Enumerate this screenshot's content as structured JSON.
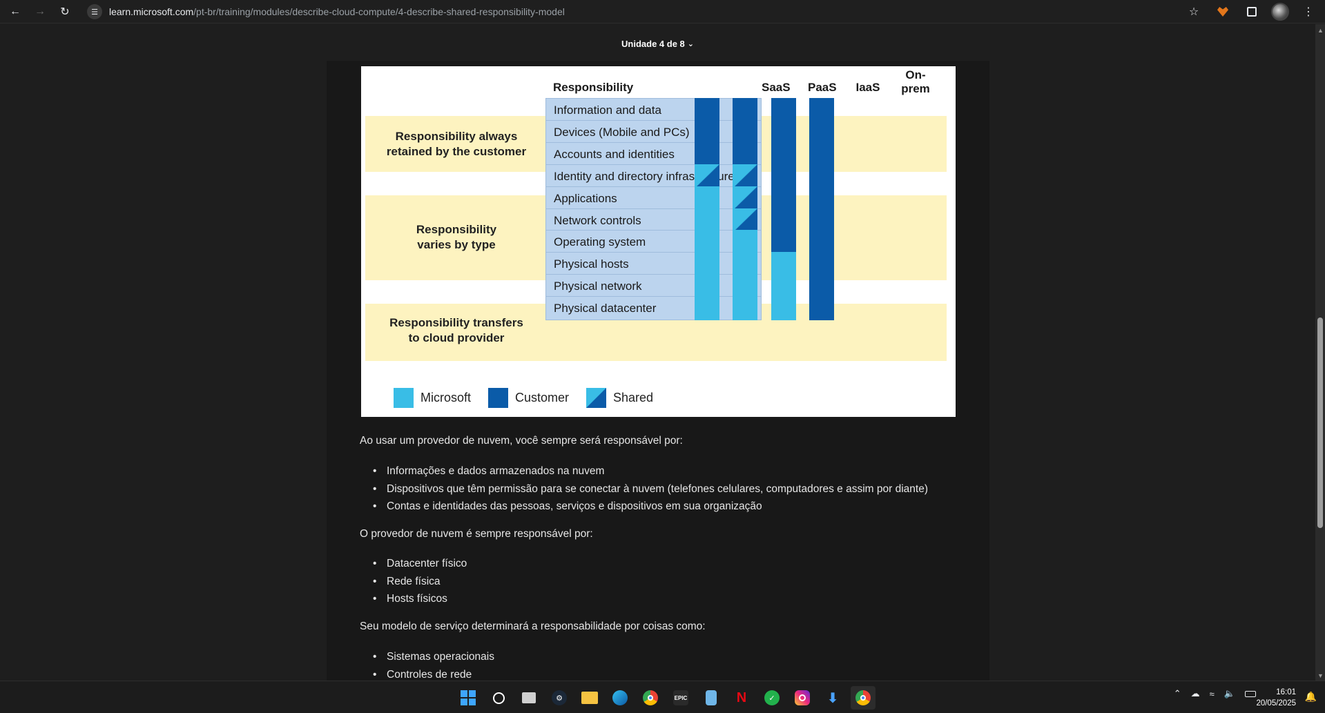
{
  "browser": {
    "back_icon": "arrow-left-icon",
    "forward_icon": "arrow-right-icon",
    "reload_icon": "reload-icon",
    "url_host": "learn.microsoft.com",
    "url_path": "/pt-br/training/modules/describe-cloud-compute/4-describe-shared-responsibility-model"
  },
  "unit_nav": {
    "label": "Unidade 4 de 8"
  },
  "diagram": {
    "header": {
      "responsibility": "Responsibility",
      "saas": "SaaS",
      "paas": "PaaS",
      "iaas": "IaaS",
      "onprem_1": "On-",
      "onprem_2": "prem"
    },
    "groups": [
      {
        "line1": "Responsibility always",
        "line2": "retained by the customer"
      },
      {
        "line1": "Responsibility",
        "line2": "varies by type"
      },
      {
        "line1": "Responsibility transfers",
        "line2": "to cloud provider"
      }
    ],
    "rows": [
      {
        "label": "Information and data",
        "cells": [
          "customer",
          "customer",
          "customer",
          "customer"
        ]
      },
      {
        "label": "Devices (Mobile and PCs)",
        "cells": [
          "customer",
          "customer",
          "customer",
          "customer"
        ]
      },
      {
        "label": "Accounts and identities",
        "cells": [
          "customer",
          "customer",
          "customer",
          "customer"
        ]
      },
      {
        "label": "Identity and directory infrastructure",
        "cells": [
          "shared",
          "shared",
          "customer",
          "customer"
        ]
      },
      {
        "label": "Applications",
        "cells": [
          "microsoft",
          "shared",
          "customer",
          "customer"
        ]
      },
      {
        "label": "Network controls",
        "cells": [
          "microsoft",
          "shared",
          "customer",
          "customer"
        ]
      },
      {
        "label": "Operating system",
        "cells": [
          "microsoft",
          "microsoft",
          "customer",
          "customer"
        ]
      },
      {
        "label": "Physical hosts",
        "cells": [
          "microsoft",
          "microsoft",
          "microsoft",
          "customer"
        ]
      },
      {
        "label": "Physical network",
        "cells": [
          "microsoft",
          "microsoft",
          "microsoft",
          "customer"
        ]
      },
      {
        "label": "Physical datacenter",
        "cells": [
          "microsoft",
          "microsoft",
          "microsoft",
          "customer"
        ]
      }
    ],
    "legend": {
      "microsoft": "Microsoft",
      "customer": "Customer",
      "shared": "Shared"
    },
    "colors": {
      "customer": "#0b5ba8",
      "microsoft": "#39bde6",
      "band": "#fdf3c0",
      "row_bg": "#bcd4ee"
    }
  },
  "article": {
    "p1": "Ao usar um provedor de nuvem, você sempre será responsável por:",
    "list1": [
      "Informações e dados armazenados na nuvem",
      "Dispositivos que têm permissão para se conectar à nuvem (telefones celulares, computadores e assim por diante)",
      "Contas e identidades das pessoas, serviços e dispositivos em sua organização"
    ],
    "p2": "O provedor de nuvem é sempre responsável por:",
    "list2": [
      "Datacenter físico",
      "Rede física",
      "Hosts físicos"
    ],
    "p3": "Seu modelo de serviço determinará a responsabilidade por coisas como:",
    "list3": [
      "Sistemas operacionais",
      "Controles de rede"
    ]
  },
  "taskbar": {
    "apps": [
      "windows-start",
      "search",
      "task-view",
      "steam",
      "file-explorer",
      "edge",
      "chrome",
      "epic-games",
      "notepad",
      "netflix",
      "app-green",
      "instagram",
      "download-manager",
      "chrome-active"
    ],
    "epic_label": "EPIC",
    "netflix_label": "N",
    "time": "16:01",
    "date": "20/05/2025"
  }
}
